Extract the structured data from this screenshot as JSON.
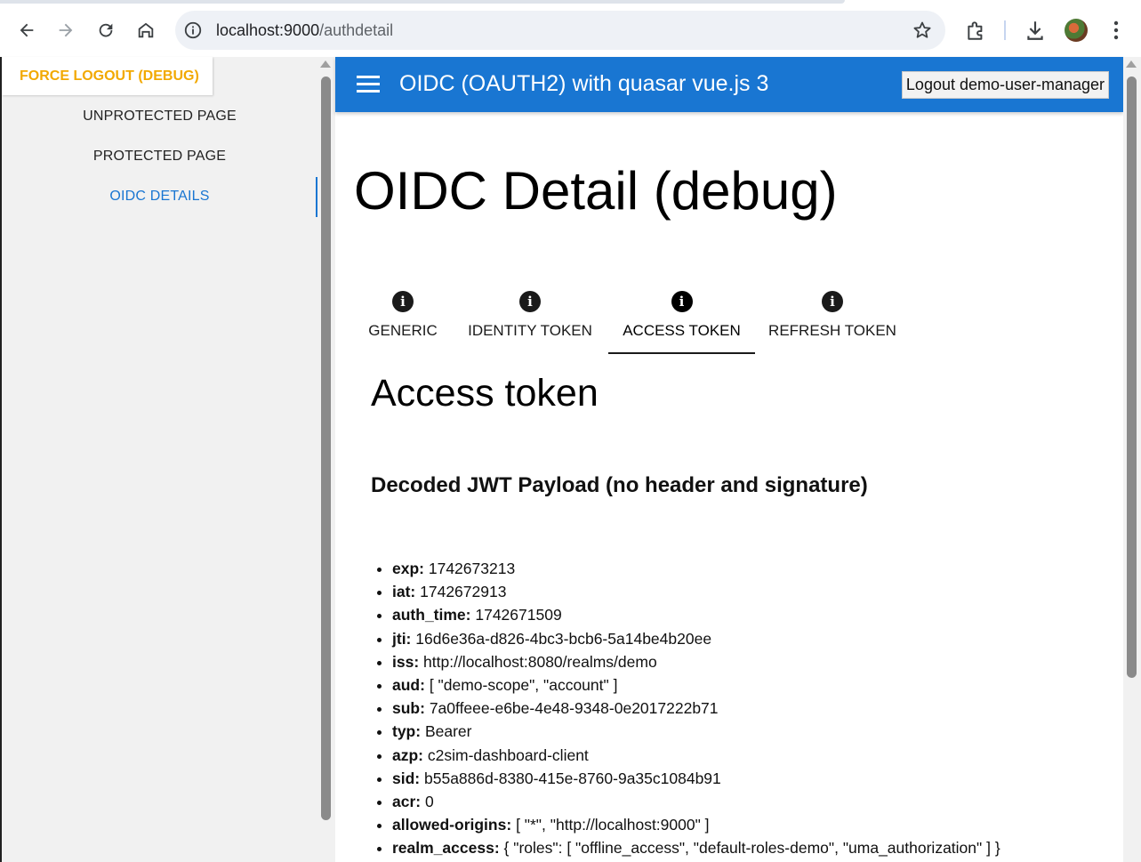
{
  "browser": {
    "url_host": "localhost:9000",
    "url_path": "/authdetail"
  },
  "drawer": {
    "force_logout": "FORCE LOGOUT (DEBUG)",
    "items": [
      {
        "label": "UNPROTECTED PAGE"
      },
      {
        "label": "PROTECTED PAGE"
      },
      {
        "label": "OIDC DETAILS",
        "active": true
      }
    ]
  },
  "header": {
    "title": "OIDC (OAUTH2) with quasar vue.js 3",
    "logout_label": "Logout demo-user-manager"
  },
  "page": {
    "title": "OIDC Detail (debug)",
    "tabs": [
      {
        "label": "GENERIC",
        "icon": "info-icon"
      },
      {
        "label": "IDENTITY TOKEN",
        "icon": "info-icon"
      },
      {
        "label": "ACCESS TOKEN",
        "icon": "info-icon",
        "active": true
      },
      {
        "label": "REFRESH TOKEN",
        "icon": "info-icon"
      }
    ],
    "section_title": "Access token",
    "subsection_title": "Decoded JWT Payload (no header and signature)",
    "claims": [
      {
        "key": "exp:",
        "value": "1742673213"
      },
      {
        "key": "iat:",
        "value": "1742672913"
      },
      {
        "key": "auth_time:",
        "value": "1742671509"
      },
      {
        "key": "jti:",
        "value": "16d6e36a-d826-4bc3-bcb6-5a14be4b20ee"
      },
      {
        "key": "iss:",
        "value": "http://localhost:8080/realms/demo"
      },
      {
        "key": "aud:",
        "value": "[ \"demo-scope\", \"account\" ]"
      },
      {
        "key": "sub:",
        "value": "7a0ffeee-e6be-4e48-9348-0e2017222b71"
      },
      {
        "key": "typ:",
        "value": "Bearer"
      },
      {
        "key": "azp:",
        "value": "c2sim-dashboard-client"
      },
      {
        "key": "sid:",
        "value": "b55a886d-8380-415e-8760-9a35c1084b91"
      },
      {
        "key": "acr:",
        "value": "0"
      },
      {
        "key": "allowed-origins:",
        "value": "[ \"*\", \"http://localhost:9000\" ]"
      },
      {
        "key": "realm_access:",
        "value": "{ \"roles\": [ \"offline_access\", \"default-roles-demo\", \"uma_authorization\" ] }"
      }
    ]
  },
  "colors": {
    "primary": "#1976d2",
    "warning": "#f2a900"
  }
}
